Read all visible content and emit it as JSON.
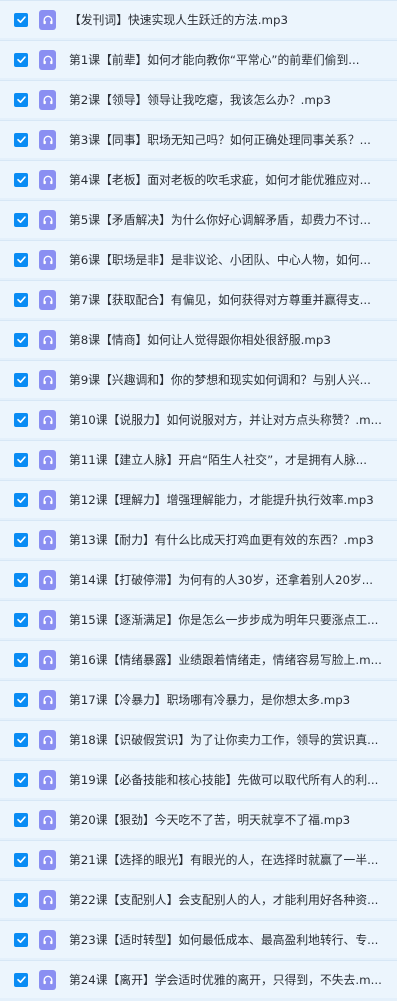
{
  "colors": {
    "background": "#e4f0fb",
    "row_background": "#ecf5fd",
    "checkbox": "#0a8cf4",
    "audio_icon": "#8a8ff2",
    "text": "#2b2f36"
  },
  "icons": {
    "checkbox": "checkmark-icon",
    "file": "headphones-icon"
  },
  "files": [
    {
      "name": "【发刊词】快速实现人生跃迁的方法.mp3",
      "checked": true
    },
    {
      "name": "第1课【前辈】如何才能向教你“平常心”的前辈们偷到...",
      "checked": true
    },
    {
      "name": "第2课【领导】领导让我吃瘪，我该怎么办？.mp3",
      "checked": true
    },
    {
      "name": "第3课【同事】职场无知己吗？如何正确处理同事关系？...",
      "checked": true
    },
    {
      "name": "第4课【老板】面对老板的吹毛求疵，如何才能优雅应对...",
      "checked": true
    },
    {
      "name": "第5课【矛盾解决】为什么你好心调解矛盾，却费力不讨...",
      "checked": true
    },
    {
      "name": "第6课【职场是非】是非议论、小团队、中心人物，如何...",
      "checked": true
    },
    {
      "name": "第7课【获取配合】有偏见，如何获得对方尊重并赢得支...",
      "checked": true
    },
    {
      "name": "第8课【情商】如何让人觉得跟你相处很舒服.mp3",
      "checked": true
    },
    {
      "name": "第9课【兴趣调和】你的梦想和现实如何调和？与别人兴...",
      "checked": true
    },
    {
      "name": "第10课【说服力】如何说服对方，并让对方点头称赞？.m...",
      "checked": true
    },
    {
      "name": "第11课【建立人脉】开启“陌生人社交”，才是拥有人脉...",
      "checked": true
    },
    {
      "name": "第12课【理解力】增强理解能力，才能提升执行效率.mp3",
      "checked": true
    },
    {
      "name": "第13课【耐力】有什么比成天打鸡血更有效的东西？.mp3",
      "checked": true
    },
    {
      "name": "第14课【打破停滞】为何有的人30岁，还拿着别人20岁...",
      "checked": true
    },
    {
      "name": "第15课【逐渐满足】你是怎么一步步成为明年只要涨点工...",
      "checked": true
    },
    {
      "name": "第16课【情绪暴露】业绩跟着情绪走，情绪容易写脸上.m...",
      "checked": true
    },
    {
      "name": "第17课【冷暴力】职场哪有冷暴力，是你想太多.mp3",
      "checked": true
    },
    {
      "name": "第18课【识破假赏识】为了让你卖力工作，领导的赏识真...",
      "checked": true
    },
    {
      "name": "第19课【必备技能和核心技能】先做可以取代所有人的利...",
      "checked": true
    },
    {
      "name": "第20课【狠劲】今天吃不了苦，明天就享不了福.mp3",
      "checked": true
    },
    {
      "name": "第21课【选择的眼光】有眼光的人，在选择时就赢了一半...",
      "checked": true
    },
    {
      "name": "第22课【支配别人】会支配别人的人，才能利用好各种资...",
      "checked": true
    },
    {
      "name": "第23课【适时转型】如何最低成本、最高盈利地转行、专...",
      "checked": true
    },
    {
      "name": "第24课【离开】学会适时优雅的离开，只得到，不失去.m...",
      "checked": true
    }
  ]
}
